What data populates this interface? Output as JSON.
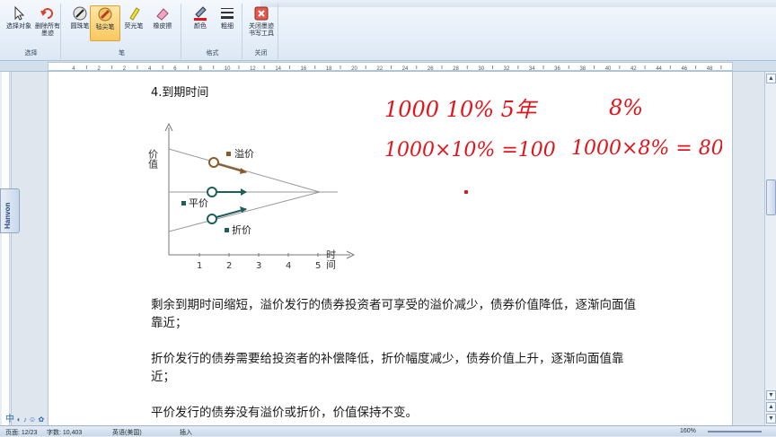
{
  "ribbon": {
    "groups": [
      {
        "name": "选择",
        "buttons": [
          {
            "label": "选择对象"
          },
          {
            "label": "删除所有墨迹"
          }
        ]
      },
      {
        "name": "笔",
        "buttons": [
          {
            "label": "圆珠笔"
          },
          {
            "label": "毡尖笔"
          },
          {
            "label": "荧光笔"
          },
          {
            "label": "橡皮擦"
          }
        ]
      },
      {
        "name": "格式",
        "buttons": [
          {
            "label": "颜色"
          },
          {
            "label": "粗细"
          }
        ]
      },
      {
        "name": "关闭",
        "buttons": [
          {
            "label": "关闭墨迹书写工具"
          }
        ]
      }
    ],
    "active_pen": "毡尖笔"
  },
  "ruler": {
    "ticks": [
      "4",
      "2",
      "2",
      "4",
      "6",
      "8",
      "10",
      "12",
      "14",
      "16",
      "18",
      "20",
      "22",
      "24",
      "26",
      "28",
      "30",
      "32",
      "34",
      "36",
      "38",
      "40",
      "42",
      "44",
      "46",
      "48"
    ]
  },
  "side_tab": {
    "label": "Hanvon"
  },
  "document": {
    "heading": "4.到期时间",
    "figure": {
      "y_label": "价值",
      "x_label": "时间",
      "x_ticks": [
        "1",
        "2",
        "3",
        "4",
        "5"
      ],
      "premium_label": "溢价",
      "par_label": "平价",
      "discount_label": "折价"
    },
    "paragraphs": [
      "剩余到期时间缩短，溢价发行的债券投资者可享受的溢价减少，债券价值降低，逐渐向面值靠近；",
      "折价发行的债券需要给投资者的补偿降低，折价幅度减少，债券价值上升，逐渐向面值靠近；",
      "平价发行的债券没有溢价或折价，价值保持不变。"
    ],
    "handwriting": {
      "line1_left": "1000  10%  5年",
      "line1_right": "8%",
      "line2_left": "1000×10% =100",
      "line2_right": "1000×8% = 80",
      "ink_color": "#e0151b"
    }
  },
  "status": {
    "page": "页面: 12/23",
    "words": "字数: 10,403",
    "language": "英语(美国)",
    "mode": "插入",
    "zoom": "160%"
  },
  "ime": {
    "label": "中"
  }
}
